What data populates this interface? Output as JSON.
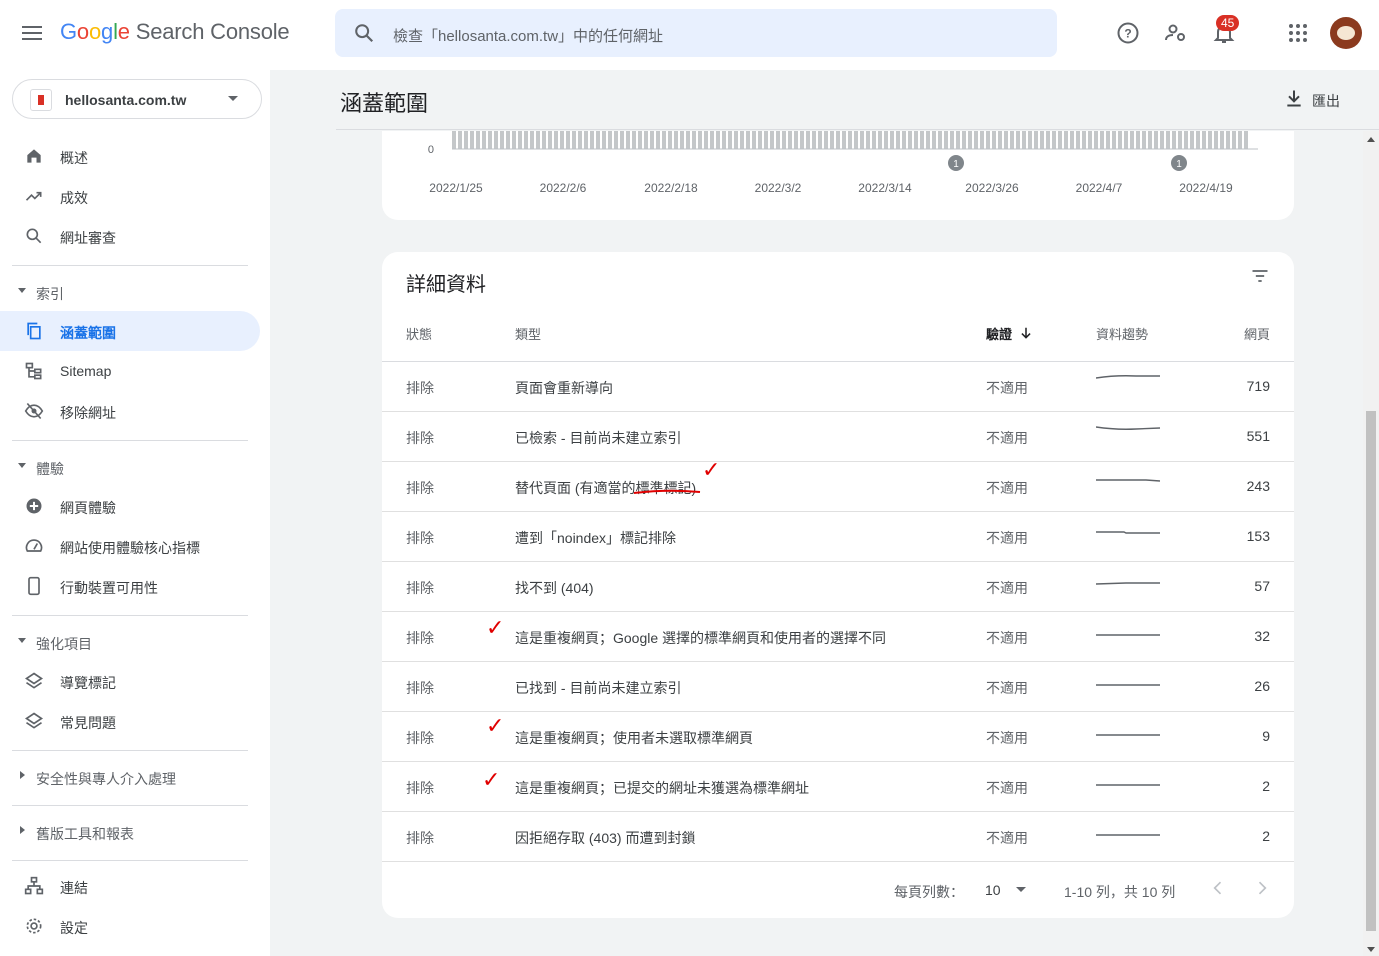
{
  "app": {
    "logo_google": "Google",
    "logo_product": "Search Console",
    "search_placeholder": "檢查「hellosanta.com.tw」中的任何網址",
    "notifications_count": "45"
  },
  "sidebar": {
    "property": "hellosanta.com.tw",
    "items_top": [
      {
        "label": "概述",
        "icon": "home-icon"
      },
      {
        "label": "成效",
        "icon": "trending-icon"
      },
      {
        "label": "網址審查",
        "icon": "search-icon"
      }
    ],
    "section_index": "索引",
    "items_index": [
      {
        "label": "涵蓋範圍",
        "icon": "copy-icon",
        "active": true
      },
      {
        "label": "Sitemap",
        "icon": "sitemap-icon"
      },
      {
        "label": "移除網址",
        "icon": "hide-icon"
      }
    ],
    "section_experience": "體驗",
    "items_experience": [
      {
        "label": "網頁體驗",
        "icon": "plus-circle-icon"
      },
      {
        "label": "網站使用體驗核心指標",
        "icon": "gauge-icon"
      },
      {
        "label": "行動裝置可用性",
        "icon": "phone-icon"
      }
    ],
    "section_enhancements": "強化項目",
    "items_enhancements": [
      {
        "label": "導覽標記",
        "icon": "layers-icon"
      },
      {
        "label": "常見問題",
        "icon": "layers-icon"
      }
    ],
    "section_security": "安全性與專人介入處理",
    "section_legacy": "舊版工具和報表",
    "items_bottom": [
      {
        "label": "連結",
        "icon": "links-icon"
      },
      {
        "label": "設定",
        "icon": "settings-icon"
      }
    ]
  },
  "page": {
    "title": "涵蓋範圍",
    "export_label": "匯出"
  },
  "chart": {
    "y_zero_label": "0",
    "x_labels": [
      "2022/1/25",
      "2022/2/6",
      "2022/2/18",
      "2022/3/2",
      "2022/3/14",
      "2022/3/26",
      "2022/4/7",
      "2022/4/19"
    ],
    "annotations": [
      "1",
      "1"
    ]
  },
  "details": {
    "title": "詳細資料",
    "columns": {
      "status": "狀態",
      "type": "類型",
      "validation": "驗證",
      "trend": "資料趨勢",
      "pages": "網頁"
    },
    "rows": [
      {
        "status": "排除",
        "type": "頁面會重新導向",
        "validation": "不適用",
        "pages": "719"
      },
      {
        "status": "排除",
        "type": "已檢索 - 目前尚未建立索引",
        "validation": "不適用",
        "pages": "551"
      },
      {
        "status": "排除",
        "type": "替代頁面 (有適當的標準標記)",
        "validation": "不適用",
        "pages": "243"
      },
      {
        "status": "排除",
        "type": "遭到「noindex」標記排除",
        "validation": "不適用",
        "pages": "153"
      },
      {
        "status": "排除",
        "type": "找不到 (404)",
        "validation": "不適用",
        "pages": "57"
      },
      {
        "status": "排除",
        "type": "這是重複網頁；Google 選擇的標準網頁和使用者的選擇不同",
        "validation": "不適用",
        "pages": "32"
      },
      {
        "status": "排除",
        "type": "已找到 - 目前尚未建立索引",
        "validation": "不適用",
        "pages": "26"
      },
      {
        "status": "排除",
        "type": "這是重複網頁；使用者未選取標準網頁",
        "validation": "不適用",
        "pages": "9"
      },
      {
        "status": "排除",
        "type": "這是重複網頁；已提交的網址未獲選為標準網址",
        "validation": "不適用",
        "pages": "2"
      },
      {
        "status": "排除",
        "type": "因拒絕存取 (403) 而遭到封鎖",
        "validation": "不適用",
        "pages": "2"
      }
    ],
    "pager": {
      "rows_per_page_label": "每頁列數：",
      "rows_per_page": "10",
      "range": "1-10 列，共 10 列"
    }
  },
  "colors": {
    "accent": "#1a73e8",
    "active_bg": "#e8f0fe",
    "annotation_red": "#e00000"
  }
}
